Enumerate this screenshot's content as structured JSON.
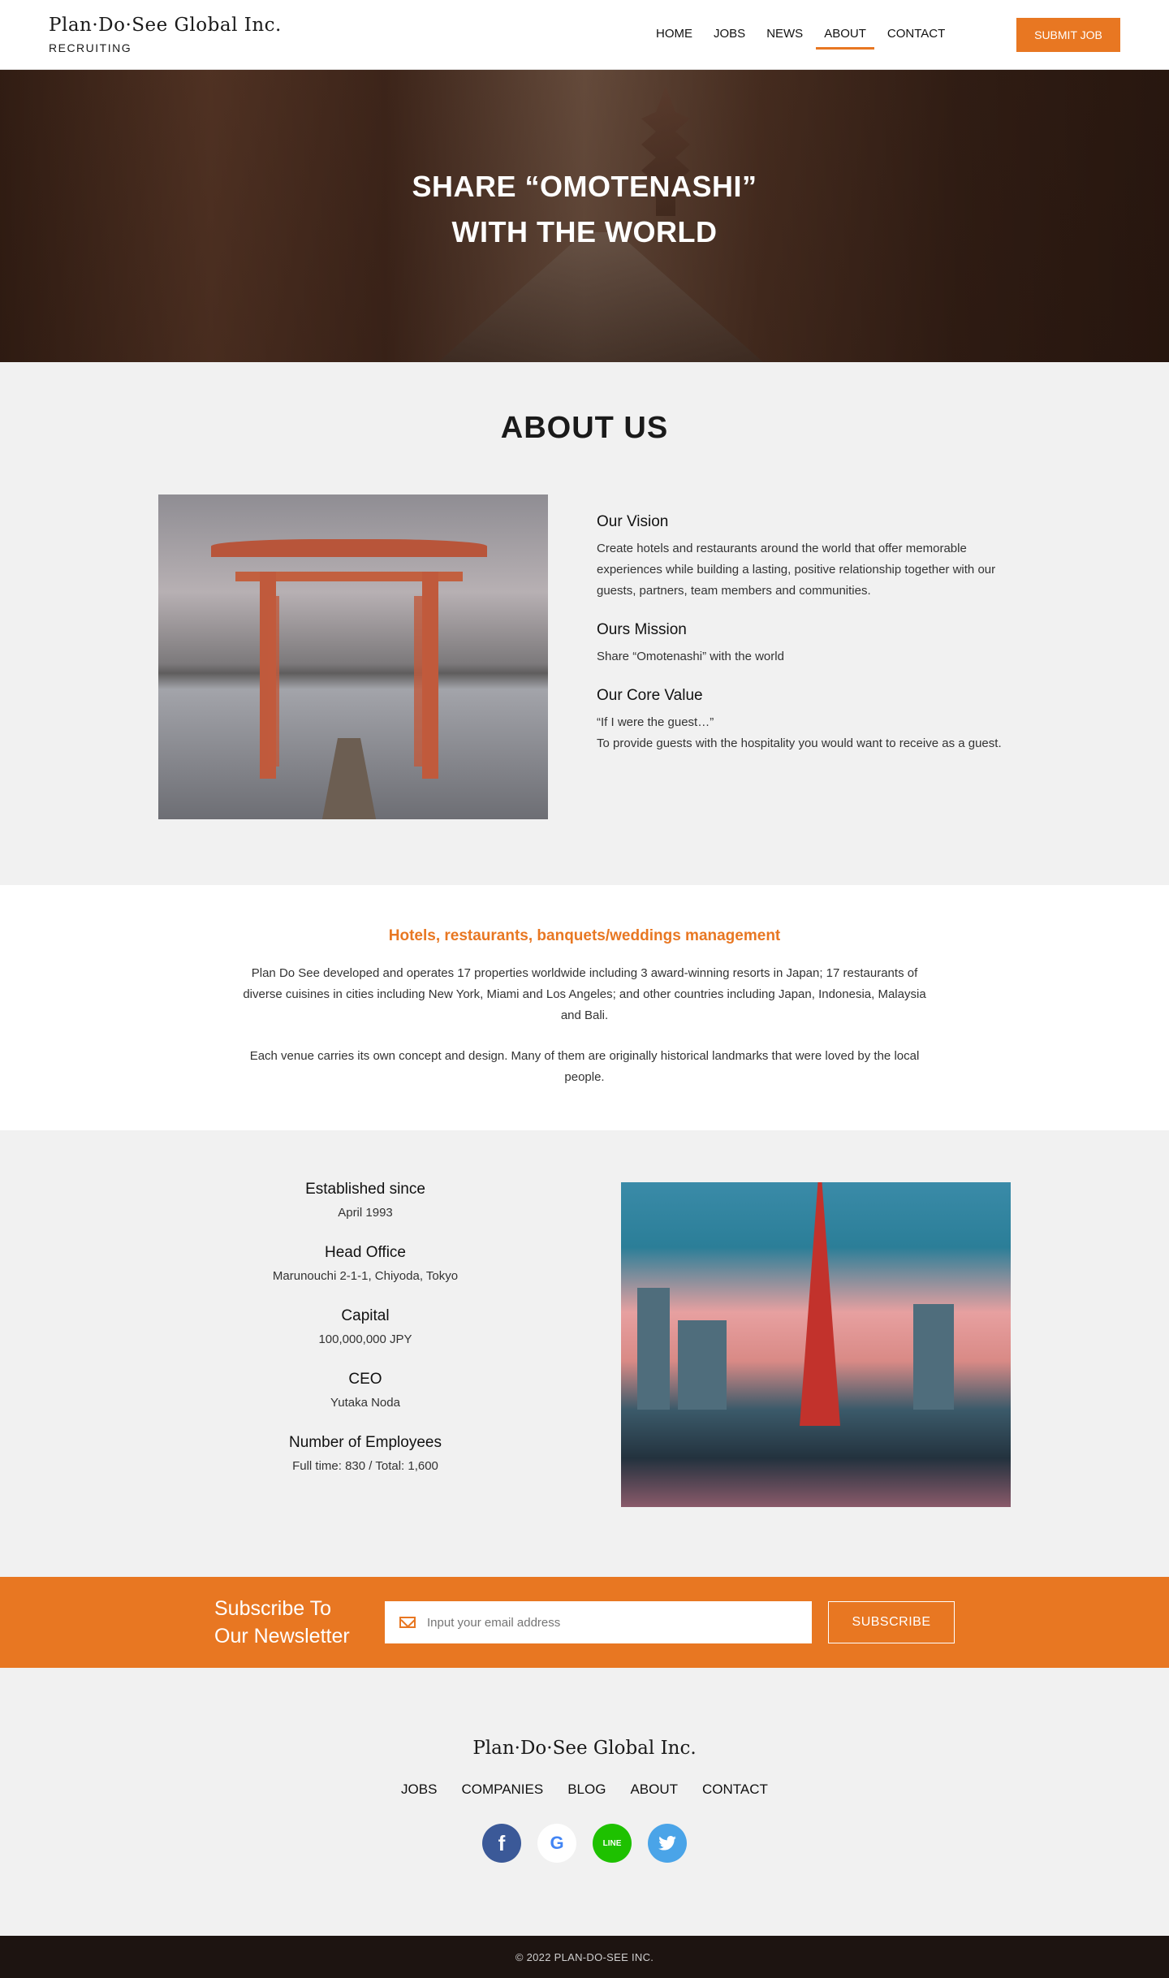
{
  "header": {
    "logo": "Plan·Do·See Global Inc.",
    "logo_sub": "RECRUITING",
    "nav": [
      "HOME",
      "JOBS",
      "NEWS",
      "ABOUT",
      "CONTACT"
    ],
    "active_nav": "ABOUT",
    "submit_label": "SUBMIT JOB"
  },
  "hero": {
    "title_line1": "SHARE “OMOTENASHI”",
    "title_line2": "WITH THE WORLD"
  },
  "about": {
    "title": "ABOUT US",
    "vision_title": "Our Vision",
    "vision_text": "Create hotels and restaurants around the world that offer memorable experiences while building a lasting, positive relationship together with our guests, partners, team members and communities.",
    "mission_title": "Ours Mission",
    "mission_text": "Share “Omotenashi” with the world",
    "core_title": "Our Core Value",
    "core_text1": "“If I were the guest…”",
    "core_text2": "To provide guests with the hospitality you would want to receive as a guest."
  },
  "management": {
    "title": "Hotels, restaurants, banquets/weddings management",
    "para1": "Plan Do See developed and operates 17 properties worldwide including 3 award-winning resorts in Japan; 17 restaurants of diverse cuisines in cities including New York, Miami and Los Angeles; and other countries including Japan, Indonesia, Malaysia and Bali.",
    "para2": "Each venue carries its own concept and design. Many of them are originally historical landmarks that were loved by the local people."
  },
  "facts": [
    {
      "label": "Established since",
      "value": "April 1993"
    },
    {
      "label": "Head Office",
      "value": "Marunouchi 2-1-1, Chiyoda, Tokyo"
    },
    {
      "label": "Capital",
      "value": "100,000,000 JPY"
    },
    {
      "label": "CEO",
      "value": "Yutaka Noda"
    },
    {
      "label": "Number of Employees",
      "value": "Full time: 830 / Total: 1,600"
    }
  ],
  "newsletter": {
    "title_line1": "Subscribe To",
    "title_line2": "Our Newsletter",
    "placeholder": "Input your email address",
    "button": "SUBSCRIBE"
  },
  "footer": {
    "logo": "Plan·Do·See Global Inc.",
    "nav": [
      "JOBS",
      "COMPANIES",
      "BLOG",
      "ABOUT",
      "CONTACT"
    ],
    "socials": [
      "facebook-icon",
      "google-icon",
      "line-icon",
      "twitter-icon"
    ],
    "copyright": "© 2022 PLAN-DO-SEE INC."
  },
  "colors": {
    "accent": "#e87722",
    "dark": "#1d1411"
  }
}
